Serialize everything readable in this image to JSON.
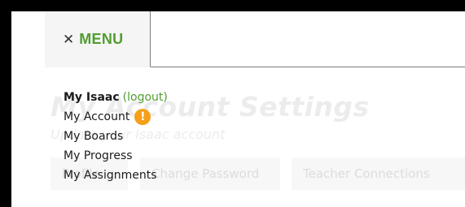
{
  "background_page": {
    "title": "My Account Settings",
    "subtitle": "Update your Isaac account",
    "tabs": [
      "Profile",
      "Change Password",
      "Teacher Connections"
    ]
  },
  "menu": {
    "toggle_icon": "close-x",
    "toggle_label": "MENU",
    "section_title": "My Isaac",
    "logout_label": "(logout)",
    "items": [
      {
        "label": "My Account",
        "alert": "!"
      },
      {
        "label": "My Boards"
      },
      {
        "label": "My Progress"
      },
      {
        "label": "My Assignments"
      }
    ]
  },
  "colors": {
    "accent_green": "#509e2f",
    "alert_orange": "#f5a019"
  }
}
